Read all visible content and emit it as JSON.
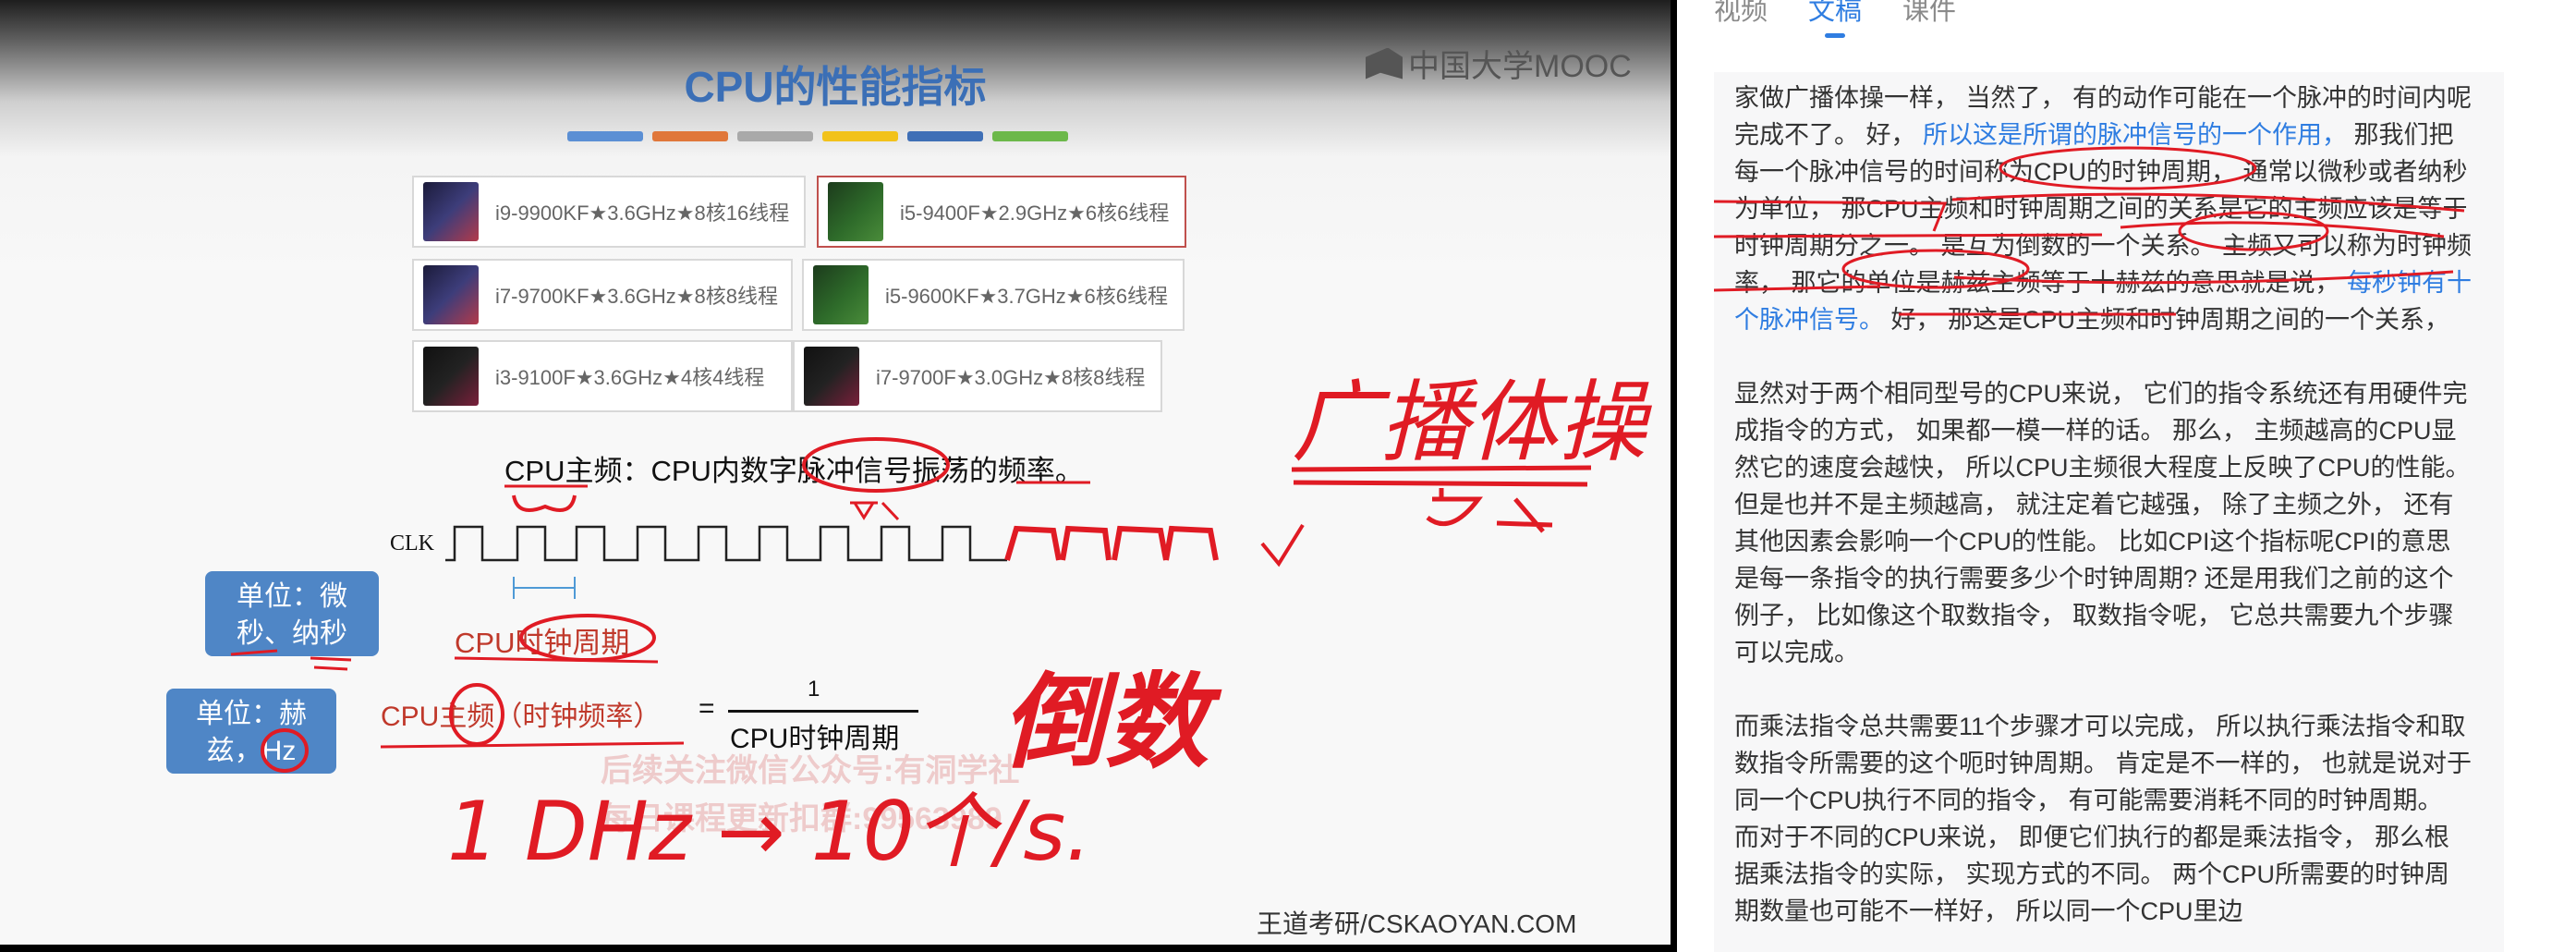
{
  "slide": {
    "title": "CPU的性能指标",
    "logo_text": "中国大学MOOC",
    "color_bars": [
      "#5b8fd4",
      "#e0773a",
      "#a9a9a9",
      "#f2c21b",
      "#3f6fb6",
      "#6cb84a"
    ],
    "cpus": [
      {
        "label": "i9-9900KF★3.6GHz★8核16线程"
      },
      {
        "label": "i5-9400F★2.9GHz★6核6线程"
      },
      {
        "label": "i7-9700KF★3.6GHz★8核8线程"
      },
      {
        "label": "i5-9600KF★3.7GHz★6核6线程"
      },
      {
        "label": "i3-9100F★3.6GHz★4核4线程"
      },
      {
        "label": "i7-9700F★3.0GHz★8核8线程"
      }
    ],
    "main_freq_def": "CPU主频：CPU内数字脉冲信号振荡的频率。",
    "clk_label": "CLK",
    "callout_period": "单位：微秒、纳秒",
    "callout_freq": "单位：赫兹，Hz",
    "clock_period_label": "CPU时钟周期",
    "freq_label": "CPU主频（时钟频率）",
    "equals": "=",
    "fraction_num": "1",
    "fraction_den": "CPU时钟周期",
    "watermark_line1": "后续关注微信公众号:有洞学社",
    "watermark_line2": "每日课程更新扣群:99563989",
    "footer": "王道考研/CSKAOYAN.COM",
    "handwriting": {
      "note_broadcast": "广播体操",
      "note_reciprocal": "倒数",
      "note_equation": "1 DHz → 10个/s."
    }
  },
  "panel": {
    "tabs": [
      {
        "label": "视频",
        "active": false
      },
      {
        "label": "文稿",
        "active": true
      },
      {
        "label": "课件",
        "active": false
      }
    ],
    "paragraphs": [
      {
        "segments": [
          {
            "text": "家做广播体操一样， 当然了， 有的动作可能在一个脉冲的时间内呢完成不了。 好， ",
            "hl": false
          },
          {
            "text": "所以这是所谓的脉冲信号的一个作用，",
            "hl": true
          },
          {
            "text": " 那我们把每一个脉冲信号的时间称为CPU的时钟周期， 通常以微秒或者纳秒为单位， 那CPU主频和时钟周期之间的关系是它的主频应该是等于时钟周期分之一。 是互为倒数的一个关系。 主频又可以称为时钟频率， 那它的单位是赫兹主频等于十赫兹的意思就是说， ",
            "hl": false
          },
          {
            "text": "每秒钟有十个脉冲信号。",
            "hl": true
          },
          {
            "text": " 好， 那这是CPU主频和时钟周期之间的一个关系，",
            "hl": false
          }
        ]
      },
      {
        "segments": [
          {
            "text": "显然对于两个相同型号的CPU来说， 它们的指令系统还有用硬件完成指令的方式， 如果都一模一样的话。 那么， 主频越高的CPU显然它的速度会越快， 所以CPU主频很大程度上反映了CPU的性能。 但是也并不是主频越高， 就注定着它越强， 除了主频之外， 还有其他因素会影响一个CPU的性能。 比如CPI这个指标呢CPI的意思是每一条指令的执行需要多少个时钟周期? 还是用我们之前的这个例子， 比如像这个取数指令， 取数指令呢， 它总共需要九个步骤可以完成。",
            "hl": false
          }
        ]
      },
      {
        "segments": [
          {
            "text": "而乘法指令总共需要11个步骤才可以完成， 所以执行乘法指令和取数指令所需要的这个呃时钟周期。 肯定是不一样的， 也就是说对于同一个CPU执行不同的指令， 有可能需要消耗不同的时钟周期。 而对于不同的CPU来说， 即便它们执行的都是乘法指令， 那么根据乘法指令的实际， 实现方式的不同。 两个CPU所需要的时钟周期数量也可能不一样好， 所以同一个CPU里边",
            "hl": false
          }
        ]
      }
    ]
  },
  "colors": {
    "accent_blue": "#2f7de1",
    "slide_title": "#3b6fb6",
    "annotation_red": "#e01b24",
    "callout_blue": "#4f86c6"
  }
}
